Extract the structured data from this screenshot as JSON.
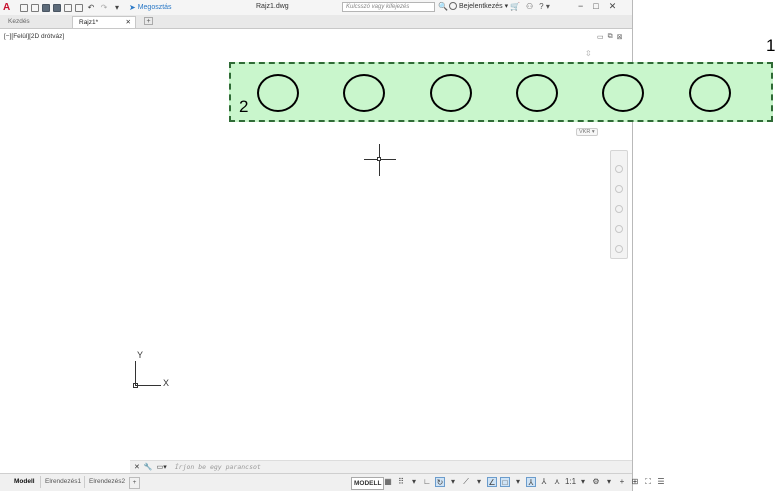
{
  "titlebar": {
    "app_letter": "A",
    "share_label": "Megosztás",
    "doc_title": "Rajz1.dwg",
    "search_placeholder": "Kulcsszó vagy kifejezés",
    "signin_label": "Bejelentkezés",
    "help_label": "?"
  },
  "tabs": {
    "home": "Kezdés",
    "active": "Rajz1*",
    "close": "✕",
    "new": "+"
  },
  "viewport": {
    "label": "[−][Felül][2D drótváz]",
    "wcs": "VKR",
    "ucs_x": "X",
    "ucs_y": "Y"
  },
  "cmdline": {
    "placeholder": "Írjon be egy parancsot"
  },
  "statusbar": {
    "layouts": [
      "Modell",
      "Elrendezés1",
      "Elrendezés2"
    ],
    "add": "+",
    "model_button": "MODELL",
    "scale": "1:1"
  },
  "annotations": {
    "label_1": "1",
    "label_2": "2",
    "circle_count": 6
  }
}
